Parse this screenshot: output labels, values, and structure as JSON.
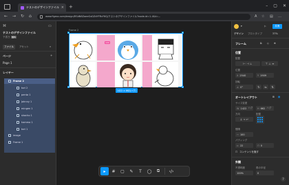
{
  "browser": {
    "tab_title": "テストのデザインファイル – Figma",
    "url": "www.figma.com/design/RSdN6ZaeeGxDZdYFRcF6Q/テストのデザインファイル?node-id=1-4&t=..."
  },
  "left_panel": {
    "file_name": "テストのデザインファイル",
    "file_sub": "下書き",
    "plan_badge": "無料",
    "tab_file": "ファイル",
    "tab_assets": "アセット",
    "pages_header": "ページ",
    "page_1": "Page 1",
    "layers_header": "レイヤー",
    "layers": [
      {
        "name": "Frame 2",
        "top": true
      },
      {
        "name": "tori 2"
      },
      {
        "name": "penta 1"
      },
      {
        "name": "Johnny 1"
      },
      {
        "name": "mingen 1"
      },
      {
        "name": "shacho 1"
      },
      {
        "name": "hamma 1"
      },
      {
        "name": "tori 1"
      }
    ],
    "below_layers": [
      {
        "name": "image"
      },
      {
        "name": "Frame 1"
      }
    ]
  },
  "canvas": {
    "frame_label": "Frame 2",
    "gap_badge": "100",
    "size_badge": "1422 × 662(ハグ)"
  },
  "toolbar": {
    "tools": [
      "▸",
      "#",
      "▢",
      "✎",
      "T",
      "◯",
      "⧉",
      "‹/›"
    ]
  },
  "right_panel": {
    "zoom": "37%",
    "share_label": "共有",
    "tab_design": "デザイン",
    "tab_prototype": "プロトタイプ",
    "frame_section": "フレーム",
    "position_section": "位置",
    "alignment_label": "配置",
    "position_label": "位置",
    "x_value": "2540",
    "y_value": "1909",
    "rotation_label": "回転",
    "rotation_value": "0°",
    "autolayout_section": "オートレイアウト",
    "size_label": "サイズ変更",
    "width_label": "W",
    "width_value": "1422",
    "width_mode": "ハグ",
    "height_label": "H",
    "height_value": "662",
    "height_mode": "ハグ",
    "direction_label": "方向",
    "align_label": "配置",
    "gap_label": "間隔",
    "gap_value": "100",
    "padding_label": "パディング",
    "hpad_value": "22",
    "vpad_value": "0",
    "clip_label": "コンテンツを隠す",
    "appearance_section": "外観",
    "opacity_label": "不透明度",
    "opacity_value": "100%",
    "radius_label": "角の半径",
    "radius_value": "0"
  }
}
